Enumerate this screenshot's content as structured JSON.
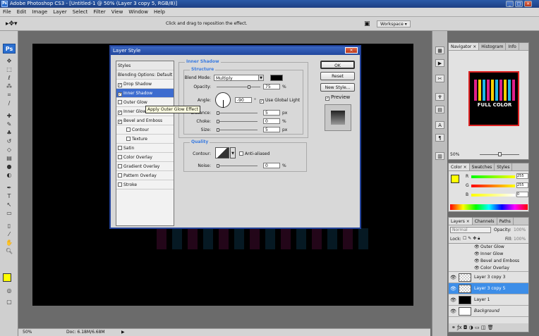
{
  "app": {
    "window_title": "Adobe Photoshop CS3 - [Untitled-1 @ 50% (Layer 3 copy 5, RGB/8)]",
    "ps_label": "Ps"
  },
  "menu": [
    "File",
    "Edit",
    "Image",
    "Layer",
    "Select",
    "Filter",
    "View",
    "Window",
    "Help"
  ],
  "options": {
    "hint": "Click and drag to reposition the effect.",
    "workspace": "Workspace ▾"
  },
  "status": {
    "zoom": "50%",
    "doc": "Doc: 6.18M/6.68M"
  },
  "dialog": {
    "title": "Layer Style",
    "styles_header": "Styles",
    "blending": "Blending Options: Default",
    "items": [
      {
        "label": "Drop Shadow",
        "checked": true
      },
      {
        "label": "Inner Shadow",
        "checked": true,
        "selected": true
      },
      {
        "label": "Outer Glow",
        "checked": false
      },
      {
        "label": "Inner Glow",
        "checked": true
      },
      {
        "label": "Bevel and Emboss",
        "checked": true
      },
      {
        "label": "Contour",
        "checked": false,
        "sub": true
      },
      {
        "label": "Texture",
        "checked": false,
        "sub": true
      },
      {
        "label": "Satin",
        "checked": false
      },
      {
        "label": "Color Overlay",
        "checked": false
      },
      {
        "label": "Gradient Overlay",
        "checked": false
      },
      {
        "label": "Pattern Overlay",
        "checked": false
      },
      {
        "label": "Stroke",
        "checked": false
      }
    ],
    "section_title": "Inner Shadow",
    "structure_title": "Structure",
    "blend_mode_label": "Blend Mode:",
    "blend_mode": "Multiply",
    "opacity_label": "Opacity:",
    "opacity": "75",
    "pct": "%",
    "angle_label": "Angle:",
    "angle": "-90",
    "deg": "°",
    "global_light": "Use Global Light",
    "distance_label": "Distance:",
    "distance": "5",
    "px": "px",
    "choke_label": "Choke:",
    "choke": "0",
    "size_label": "Size:",
    "size": "5",
    "quality_title": "Quality",
    "contour_label": "Contour:",
    "antialiased": "Anti-aliased",
    "noise_label": "Noise:",
    "noise": "0",
    "ok": "OK",
    "reset": "Reset",
    "new_style": "New Style...",
    "preview": "Preview",
    "tooltip": "Apply Outer Glow Effect"
  },
  "navigator": {
    "tabs": [
      "Navigator ×",
      "Histogram",
      "Info"
    ],
    "preview_text": "FULL COLOR",
    "zoom": "50%"
  },
  "color": {
    "tabs": [
      "Color ×",
      "Swatches",
      "Styles"
    ],
    "r_label": "R",
    "g_label": "G",
    "b_label": "B",
    "r": "255",
    "g": "255",
    "b": "0",
    "fg": "#ffff00"
  },
  "layers": {
    "tabs": [
      "Layers ×",
      "Channels",
      "Paths"
    ],
    "mode": "Normal",
    "opacity_label": "Opacity:",
    "opacity": "100%",
    "lock_label": "Lock:",
    "fill_label": "Fill:",
    "fill": "100%",
    "effects": [
      "Outer Glow",
      "Inner Glow",
      "Bevel and Emboss",
      "Color Overlay"
    ],
    "rows": [
      {
        "name": "Layer 3 copy 3",
        "selected": false
      },
      {
        "name": "Layer 3 copy 5",
        "selected": true
      },
      {
        "name": "Layer 1",
        "selected": false
      },
      {
        "name": "Background",
        "selected": false
      }
    ]
  }
}
